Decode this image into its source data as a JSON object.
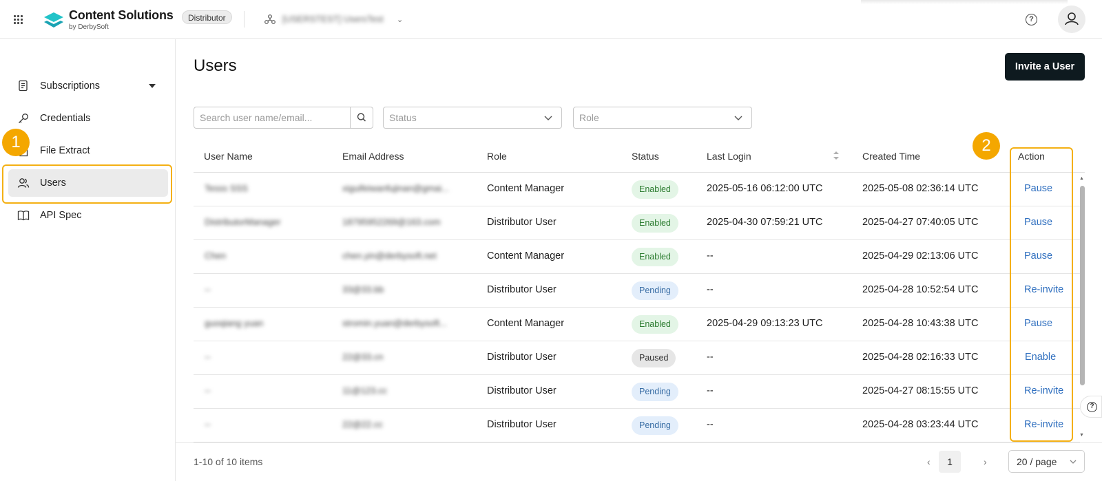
{
  "header": {
    "brand_title": "Content Solutions",
    "brand_sub": "by DerbySoft",
    "role_badge": "Distributor",
    "org_name": "[USERSTEST] UsersTest",
    "help_label": "?"
  },
  "sidebar": {
    "items": [
      {
        "label": "Subscriptions",
        "icon": "subscriptions-icon"
      },
      {
        "label": "Credentials",
        "icon": "key-icon"
      },
      {
        "label": "File Extract",
        "icon": "file-icon"
      },
      {
        "label": "Users",
        "icon": "users-icon",
        "active": true
      },
      {
        "label": "API Spec",
        "icon": "book-icon"
      }
    ]
  },
  "annotations": {
    "step1": "1",
    "step2": "2",
    "highlight_color": "#f4b013"
  },
  "main": {
    "title": "Users",
    "invite_button": "Invite a User",
    "search_placeholder": "Search user name/email...",
    "status_placeholder": "Status",
    "role_placeholder": "Role"
  },
  "table": {
    "columns": [
      "User Name",
      "Email Address",
      "Role",
      "Status",
      "Last Login",
      "Created Time",
      "Action"
    ],
    "rows": [
      {
        "user": "Tesss SSS",
        "email": "xiguifeiwanfujinan@gmai...",
        "role": "Content Manager",
        "status": "Enabled",
        "last_login": "2025-05-16 06:12:00 UTC",
        "created": "2025-05-08 02:36:14 UTC",
        "action": "Pause"
      },
      {
        "user": "DistributorManager",
        "email": "18795952269@163.com",
        "role": "Distributor User",
        "status": "Enabled",
        "last_login": "2025-04-30 07:59:21 UTC",
        "created": "2025-04-27 07:40:05 UTC",
        "action": "Pause"
      },
      {
        "user": "Chen",
        "email": "chen.yin@derbysoft.net",
        "role": "Content Manager",
        "status": "Enabled",
        "last_login": "--",
        "created": "2025-04-29 02:13:06 UTC",
        "action": "Pause"
      },
      {
        "user": "--",
        "email": "33@33.bb",
        "role": "Distributor User",
        "status": "Pending",
        "last_login": "--",
        "created": "2025-04-28 10:52:54 UTC",
        "action": "Re-invite"
      },
      {
        "user": "guoqiang yuan",
        "email": "stromin.yuan@derbysoft...",
        "role": "Content Manager",
        "status": "Enabled",
        "last_login": "2025-04-29 09:13:23 UTC",
        "created": "2025-04-28 10:43:38 UTC",
        "action": "Pause"
      },
      {
        "user": "--",
        "email": "22@33.cn",
        "role": "Distributor User",
        "status": "Paused",
        "last_login": "--",
        "created": "2025-04-28 02:16:33 UTC",
        "action": "Enable"
      },
      {
        "user": "--",
        "email": "11@123.cc",
        "role": "Distributor User",
        "status": "Pending",
        "last_login": "--",
        "created": "2025-04-27 08:15:55 UTC",
        "action": "Re-invite"
      },
      {
        "user": "--",
        "email": "22@22.cc",
        "role": "Distributor User",
        "status": "Pending",
        "last_login": "--",
        "created": "2025-04-28 03:23:44 UTC",
        "action": "Re-invite"
      }
    ]
  },
  "footer": {
    "range_text": "1-10 of 10 items",
    "current_page": "1",
    "page_size": "20 / page",
    "prev": "‹",
    "next": "›"
  },
  "colors": {
    "accent_dark": "#0e1a1f",
    "link": "#2f6fbf",
    "logo": "#22c3c8"
  }
}
